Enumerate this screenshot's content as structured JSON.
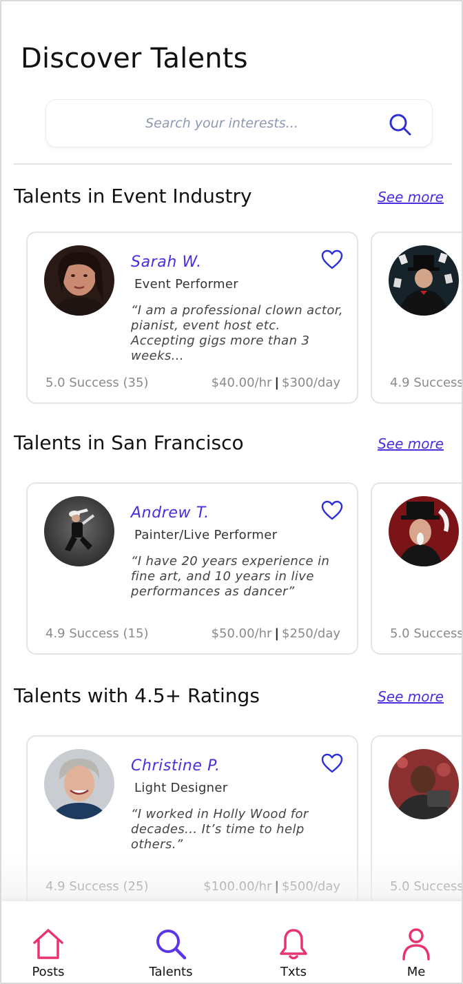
{
  "page": {
    "title": "Discover Talents"
  },
  "search": {
    "placeholder": "Search your interests..."
  },
  "sections": [
    {
      "title": "Talents in Event Industry",
      "see_more": "See more",
      "card": {
        "name": "Sarah W.",
        "role": "Event Performer",
        "quote": "“I am a professional clown actor, pianist, event host etc. Accepting gigs more than 3 weeks...",
        "success": "5.0 Success (35)",
        "hourly": "$40.00/hr",
        "separator": "|",
        "daily": "$300/day"
      },
      "peek": {
        "success": "4.9 Success"
      }
    },
    {
      "title": "Talents in San Francisco",
      "see_more": "See more",
      "card": {
        "name": "Andrew T.",
        "role": "Painter/Live Performer",
        "quote": "“I have 20 years experience in fine art, and 10 years in live performances as dancer”",
        "success": "4.9 Success (15)",
        "hourly": "$50.00/hr",
        "separator": "|",
        "daily": "$250/day"
      },
      "peek": {
        "success": "5.0 Success"
      }
    },
    {
      "title": "Talents with 4.5+ Ratings",
      "see_more": "See more",
      "card": {
        "name": "Christine P.",
        "role": "Light Designer",
        "quote": "“I worked in Holly Wood for decades... It’s time to help others.”",
        "success": "4.9 Success (25)",
        "hourly": "$100.00/hr",
        "separator": "|",
        "daily": "$500/day"
      },
      "peek": {
        "success": "5.0 Success"
      }
    }
  ],
  "nav": [
    {
      "label": "Posts",
      "icon": "home-icon"
    },
    {
      "label": "Talents",
      "icon": "search-icon"
    },
    {
      "label": "Txts",
      "icon": "bell-icon"
    },
    {
      "label": "Me",
      "icon": "user-icon"
    }
  ],
  "colors": {
    "accent": "#4a2ee0",
    "nav_pink": "#e8336e",
    "nav_active": "#5b35e8",
    "muted_text": "#8a8a8a",
    "card_border": "#e4e4e4"
  }
}
